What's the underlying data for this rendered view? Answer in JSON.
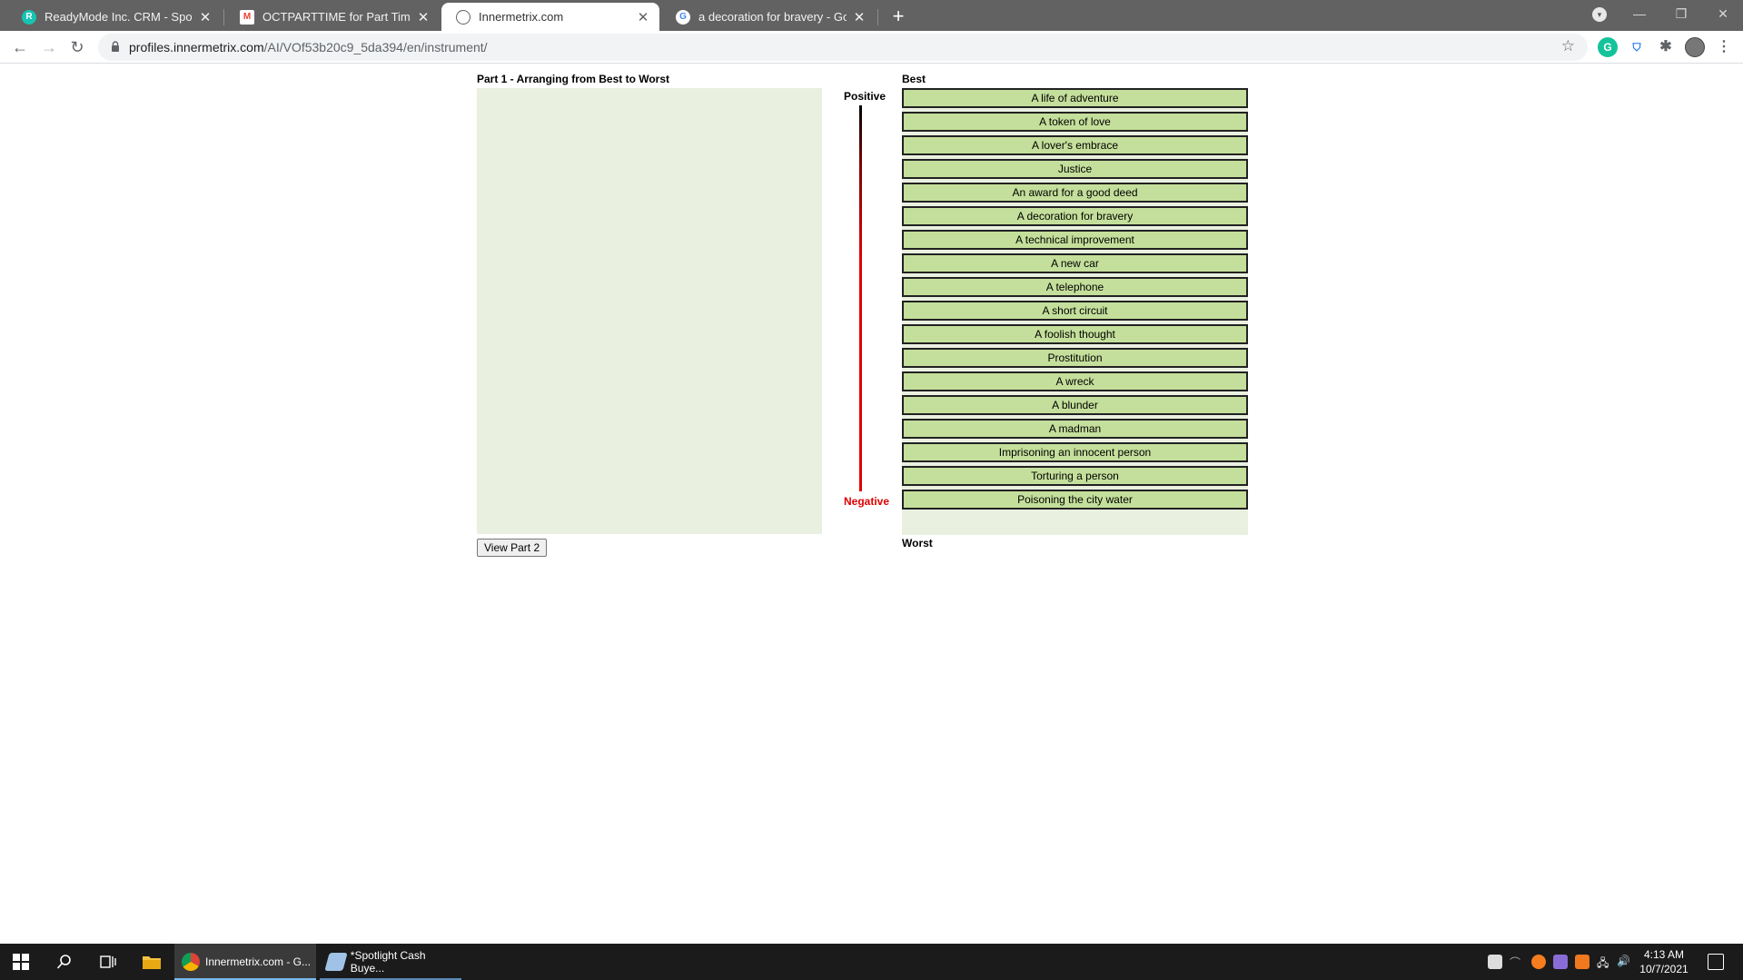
{
  "browser": {
    "tabs": [
      {
        "title": "ReadyMode Inc. CRM - Spotlight",
        "active": false,
        "favicon_color": "#17c3b2"
      },
      {
        "title": "OCTPARTTIME for Part Time App",
        "active": false,
        "favicon_color": "#ea4335"
      },
      {
        "title": "Innermetrix.com",
        "active": true,
        "favicon_color": "#5f6368"
      },
      {
        "title": "a decoration for bravery - Google",
        "active": false,
        "favicon_color": "#4285f4"
      }
    ],
    "url_host": "profiles.innermetrix.com",
    "url_path": "/AI/VOf53b20c9_5da394/en/instrument/"
  },
  "page": {
    "part_title": "Part 1 - Arranging from Best to Worst",
    "view_button": "View Part 2",
    "best_label": "Best",
    "worst_label": "Worst",
    "positive_label": "Positive",
    "negative_label": "Negative",
    "items": [
      "A life of adventure",
      "A token of love",
      "A lover's embrace",
      "Justice",
      "An award for a good deed",
      "A decoration for bravery",
      "A technical improvement",
      "A new car",
      "A telephone",
      "A short circuit",
      "A foolish thought",
      "Prostitution",
      "A wreck",
      "A blunder",
      "A madman",
      "Imprisoning an innocent person",
      "Torturing a person",
      "Poisoning the city water"
    ]
  },
  "taskbar": {
    "apps": [
      {
        "label": "Innermetrix.com - G..."
      },
      {
        "label": "*Spotlight Cash Buye..."
      }
    ],
    "time": "4:13 AM",
    "date": "10/7/2021"
  },
  "colors": {
    "item_bg": "#c4df9b",
    "panel_bg": "#eaf0e0",
    "negative": "#e00000"
  }
}
